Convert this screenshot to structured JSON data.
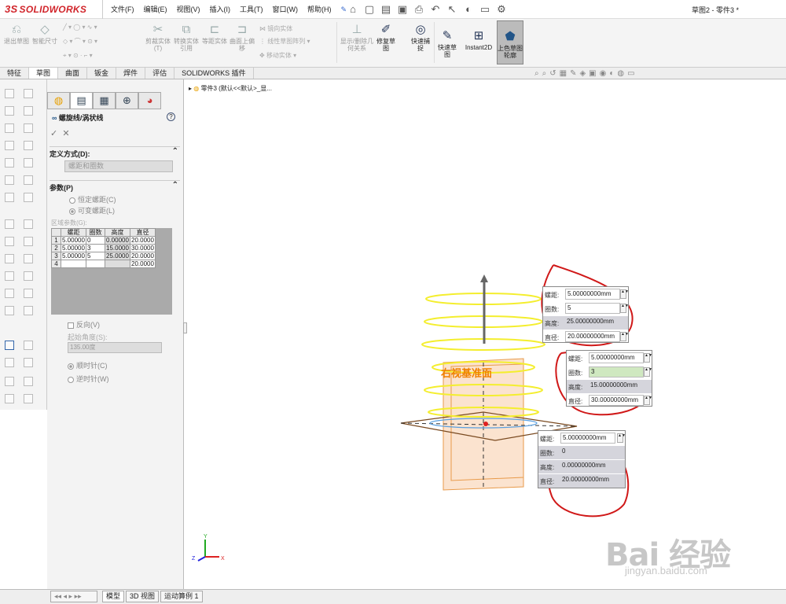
{
  "app": {
    "logo": "SOLIDWORKS",
    "doc_title": "草图2 - 零件3 *"
  },
  "menu": [
    "文件(F)",
    "编辑(E)",
    "视图(V)",
    "插入(I)",
    "工具(T)",
    "窗口(W)",
    "帮助(H)"
  ],
  "ribbon": {
    "exit_sketch": "退出草图",
    "smart_dim": "智能尺寸",
    "trim": "剪裁实体(T)",
    "convert": "转换实体引用",
    "offset": "等距实体",
    "surface_offset": "曲面上偏移",
    "mirror": "镜向实体",
    "linear_pattern": "线性草图阵列",
    "move": "移动实体",
    "display_relations": "显示/删除几何关系",
    "repair": "修复草图",
    "quick_snap": "快速捕捉",
    "rapid_sketch": "快速草图",
    "instant2d": "Instant2D",
    "shaded_sketch": "上色草图轮廓"
  },
  "tabs": [
    "特征",
    "草图",
    "曲面",
    "钣金",
    "焊件",
    "评估",
    "SOLIDWORKS 插件"
  ],
  "active_tab": "草图",
  "pm": {
    "title": "螺旋线/涡状线",
    "define_by": {
      "label": "定义方式(D):",
      "value": "螺距和圈数"
    },
    "params": {
      "label": "参数(P)",
      "opt_constant": "恒定螺距(C)",
      "opt_variable": "可变螺距(L)"
    },
    "region_label": "区域参数(G):",
    "table": {
      "headers": [
        "螺距",
        "圈数",
        "高度",
        "直径"
      ],
      "rows": [
        {
          "n": "1",
          "pitch": "5.00000",
          "rev": "0",
          "height": "0.00000",
          "dia": "20.0000"
        },
        {
          "n": "2",
          "pitch": "5.00000",
          "rev": "3",
          "height": "15.0000",
          "dia": "30.0000"
        },
        {
          "n": "3",
          "pitch": "5.00000",
          "rev": "5",
          "height": "25.0000",
          "dia": "20.0000"
        },
        {
          "n": "4",
          "pitch": "",
          "rev": "",
          "height": "",
          "dia": "20.0000"
        }
      ]
    },
    "reverse": "反向(V)",
    "start_angle_label": "起始角度(S):",
    "start_angle": "135.00度",
    "cw": "顺时针(C)",
    "ccw": "逆时针(W)"
  },
  "tree": {
    "item": "零件3 (默认<<默认>_显..."
  },
  "canvas": {
    "plane_label": "右视基准面",
    "popups": [
      {
        "pitch_label": "螺距:",
        "pitch": "5.00000000mm",
        "rev_label": "圈数:",
        "rev": "5",
        "height_label": "高度:",
        "height": "25.00000000mm",
        "dia_label": "直径:",
        "dia": "20.00000000mm"
      },
      {
        "pitch_label": "螺距:",
        "pitch": "5.00000000mm",
        "rev_label": "圈数:",
        "rev": "3",
        "height_label": "高度:",
        "height": "15.00000000mm",
        "dia_label": "直径:",
        "dia": "30.00000000mm"
      },
      {
        "pitch_label": "螺距:",
        "pitch": "5.00000000mm",
        "rev_label": "圈数:",
        "rev": "0",
        "height_label": "高度:",
        "height": "0.00000000mm",
        "dia_label": "直径:",
        "dia": "20.00000000mm"
      }
    ]
  },
  "bottom_tabs": [
    "模型",
    "3D 视图",
    "运动算例 1"
  ],
  "watermark": {
    "main": "Bai 经验",
    "sub": "jingyan.baidu.com"
  }
}
